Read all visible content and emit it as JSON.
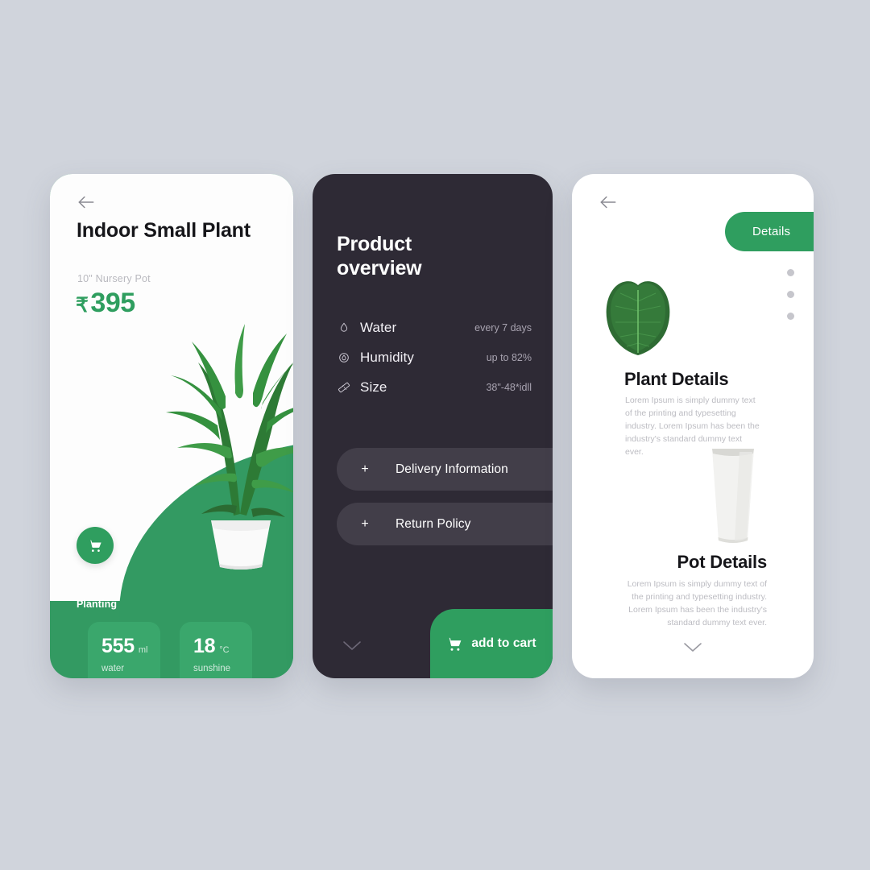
{
  "theme": {
    "background": "#d0d4dc",
    "green": "#2f9e5f",
    "dark": "#2e2a35",
    "white": "#ffffff",
    "muted_text": "#bcbcc2"
  },
  "product_card": {
    "back_icon": "arrow-left-icon",
    "title": "Indoor Small Plant",
    "subtitle": "10\" Nursery Pot",
    "currency_symbol": "₹",
    "price": "395",
    "cart_icon": "shopping-cart-icon",
    "hero_image": "indoor-plant-photo",
    "section_label": "Planting",
    "stats": [
      {
        "value": "555",
        "unit": "ml",
        "label": "water"
      },
      {
        "value": "18",
        "unit": "°C",
        "label": "sunshine"
      }
    ]
  },
  "overview_card": {
    "title": "Product overview",
    "specs": [
      {
        "icon": "water-drop-icon",
        "name": "Water",
        "value": "every 7 days"
      },
      {
        "icon": "humidity-icon",
        "name": "Humidity",
        "value": "up to 82%"
      },
      {
        "icon": "ruler-icon",
        "name": "Size",
        "value": "38\"-48*idll"
      }
    ],
    "accordions": [
      {
        "plus": "+",
        "label": "Delivery Information"
      },
      {
        "plus": "+",
        "label": "Return Policy"
      }
    ],
    "scroll_icon": "chevron-down-icon",
    "cart_button": {
      "icon": "shopping-cart-icon",
      "label": "add to cart"
    }
  },
  "details_card": {
    "back_icon": "arrow-left-icon",
    "pill_label": "Details",
    "pagination_dots": 3,
    "leaf_image": "leaf-photo",
    "plant": {
      "heading": "Plant Details",
      "body": "Lorem Ipsum is simply dummy text of the printing and typesetting industry. Lorem Ipsum has been the industry's standard dummy text ever."
    },
    "pot_image": "pot-photo",
    "pot": {
      "heading": "Pot Details",
      "body": "Lorem Ipsum is simply dummy text of the printing and typesetting industry. Lorem Ipsum has been the industry's standard dummy text ever."
    },
    "scroll_icon": "chevron-down-icon"
  }
}
